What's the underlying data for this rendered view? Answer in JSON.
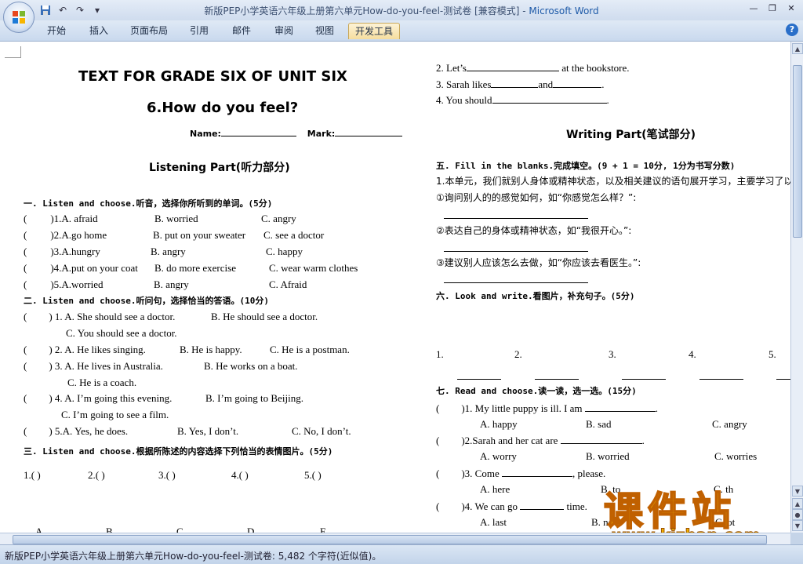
{
  "window": {
    "title_doc": "新版PEP小学英语六年级上册第六单元How-do-you-feel-测试卷 [兼容模式] - ",
    "title_app": "Microsoft Word"
  },
  "ribbon": {
    "tabs": [
      "开始",
      "插入",
      "页面布局",
      "引用",
      "邮件",
      "审阅",
      "视图",
      "开发工具"
    ],
    "active_tab": "开发工具"
  },
  "status": {
    "text": "新版PEP小学英语六年级上册第六单元How-do-you-feel-测试卷: 5,482 个字符(近似值)。"
  },
  "doc": {
    "left": {
      "heading": "TEXT FOR GRADE SIX OF UNIT SIX",
      "subheading": "6.How do you feel?",
      "name_label": "Name:",
      "mark_label": "Mark:",
      "listening": "Listening Part(听力部分)",
      "s1_title": "一. Listen and choose.听音，选择你所听到的单词。(5分)",
      "s1_items": [
        {
          "p": "(",
          "q": ")1.A. afraid",
          "b": "B. worried",
          "c": "C. angry"
        },
        {
          "p": "(",
          "q": ")2.A.go home",
          "b": "B. put on your sweater",
          "c": "C. see a doctor"
        },
        {
          "p": "(",
          "q": ")3.A.hungry",
          "b": "B. angry",
          "c": "C. happy"
        },
        {
          "p": "(",
          "q": ")4.A.put on your coat",
          "b": "B. do more exercise",
          "c": "C. wear warm clothes"
        },
        {
          "p": "(",
          "q": ")5.A.worried",
          "b": "B. angry",
          "c": "C. Afraid"
        }
      ],
      "s2_title": "二. Listen and choose.听问句，选择恰当的答语。(10分)",
      "s2_items": [
        {
          "p": "(",
          "q": ") 1. A. She should see a doctor.",
          "b": "B. He should see  a doctor."
        },
        {
          "cont": "C. You should see a doctor."
        },
        {
          "p": "(",
          "q": ") 2. A. He likes singing.",
          "b": "B. He is happy.",
          "c": "C. He is a postman."
        },
        {
          "p": "(",
          "q": ") 3. A. He lives in Australia.",
          "b": "B. He works on a boat."
        },
        {
          "cont": "C. He is a coach."
        },
        {
          "p": "(",
          "q": ") 4. A. I’m going this evening.",
          "b": "B. I’m going to Beijing."
        },
        {
          "cont": "C. I’m going to see a film."
        },
        {
          "p": "(",
          "q": ") 5.A. Yes, he does.",
          "b": "B. Yes, I don’t.",
          "c": "C. No, I don’t."
        }
      ],
      "s3_title": "三. Listen and choose.根据所陈述的内容选择下列恰当的表情图片。(5分)",
      "s3_answers": [
        "1.(      )",
        "2.(      )",
        "3.(      )",
        "4.(      )",
        "5.(      )"
      ],
      "s3_letters": [
        "A",
        "B",
        "C",
        "D",
        "E"
      ]
    },
    "right": {
      "top_items": [
        {
          "pre": "2. Let’s",
          "post": " at the bookstore."
        },
        {
          "pre": "3. Sarah likes",
          "mid": "and",
          "post": "."
        },
        {
          "pre": "4. You should",
          "post": "."
        }
      ],
      "writing": "Writing Part(笔试部分)",
      "s5_title": "五. Fill in the blanks.完成填空。(9 + 1 = 10分, 1分为书写分数)",
      "s5_intro": "1.本单元，我们就别人身体或精神状态，以及相关建议的语句展开学习，主要学习了以",
      "s5_q1": "①询问别人的的感觉如何，如“你感觉怎么样？”:",
      "s5_q2": "②表达自己的身体或精神状态，如“我很开心。”:",
      "s5_q3": "③建议别人应该怎么去做，如“你应该去看医生。”:",
      "s6_title": "六. Look and write.看图片，补充句子。(5分)",
      "s6_numbers": [
        "1.",
        "2.",
        "3.",
        "4.",
        "5."
      ],
      "s7_title": "七. Read and choose.读一读，选一选。(15分)",
      "s7_items": [
        {
          "q": ")1. My little puppy is ill. I am",
          "post": ".",
          "a": "A. happy",
          "b": "B. sad",
          "c": "C. angry"
        },
        {
          "q": ")2.Sarah and her cat are",
          "post": ".",
          "a": "A. worry",
          "b": "B. worried",
          "c": "C. worries"
        },
        {
          "q": ")3. Come",
          "post": ", please.",
          "a": "A. here",
          "b": "B. to",
          "c": "C. th"
        },
        {
          "q": ")4. We can go",
          "post": " time.",
          "a": "A. last",
          "b": "B. ne",
          "c": "C. ot"
        }
      ]
    }
  },
  "watermark": {
    "cn": "课件站",
    "url": "www.kjzhan.com"
  }
}
